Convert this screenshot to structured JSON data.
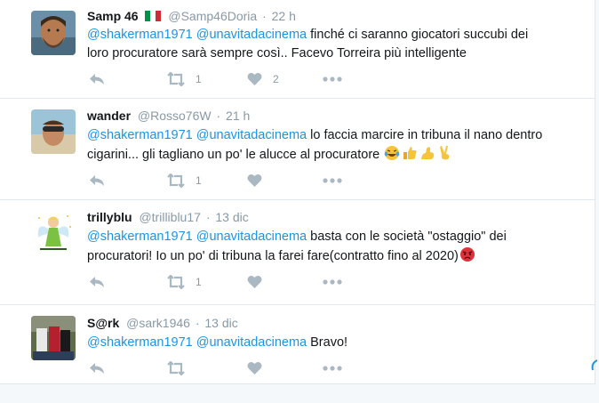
{
  "tweets": [
    {
      "name": "Samp 46",
      "handle": "@Samp46Doria",
      "time": "22 h",
      "mention1": "@shakerman1971",
      "mention2": "@unavitadacinema",
      "text_line1": "finché ci saranno giocatori succubi dei",
      "text_line2": "loro procuratore sarà sempre così.. Facevo Torreira più intelligente",
      "retweets": "1",
      "likes": "2"
    },
    {
      "name": "wander",
      "handle": "@Rosso76W",
      "time": "21 h",
      "mention1": "@shakerman1971",
      "mention2": "@unavitadacinema",
      "text_line1": "lo faccia marcire in tribuna il nano dentro",
      "text_line2": "cigarini... gli tagliano un po' le alucce al procuratore",
      "retweets": "1",
      "likes": ""
    },
    {
      "name": "trillyblu",
      "handle": "@trilliblu17",
      "time": "13 dic",
      "mention1": "@shakerman1971",
      "mention2": "@unavitadacinema",
      "text_line1": "basta con le società \"ostaggio\" dei",
      "text_line2": "procuratori! Io un po' di tribuna la farei fare(contratto fino al 2020)",
      "retweets": "1",
      "likes": ""
    },
    {
      "name": "S@rk",
      "handle": "@sark1946",
      "time": "13 dic",
      "mention1": "@shakerman1971",
      "mention2": "@unavitadacinema",
      "text_line1": "Bravo!",
      "retweets": "",
      "likes": ""
    }
  ],
  "icons": {
    "reply": "reply-icon",
    "retweet": "retweet-icon",
    "like": "heart-icon",
    "more": "more-icon",
    "flag": "italy-flag-icon"
  },
  "colors": {
    "link": "#1b95e0",
    "icon": "#aab8c2",
    "meta": "#8899a6",
    "text": "#14171a",
    "border": "#e1e8ed"
  }
}
